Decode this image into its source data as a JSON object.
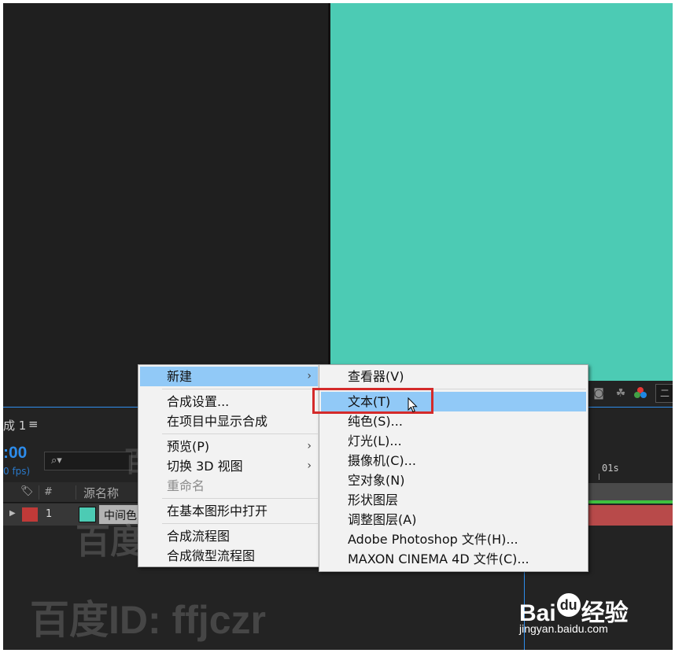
{
  "composition": {
    "canvas_color": "#4ccbb4",
    "tab_label": "成 1",
    "tab_menu": "≡",
    "timecode": ":00",
    "fps": "0 fps)",
    "search_glyph": "⌕▾"
  },
  "layers": {
    "col_num": "#",
    "col_source_name": "源名称",
    "rows": [
      {
        "expand": "▶",
        "label_color": "#c03a38",
        "number": "1",
        "name": "中间色"
      }
    ]
  },
  "timeline": {
    "ruler_label": "01s",
    "accent": "#2d8ceb",
    "bar_color": "#b84a4a"
  },
  "context_menu": {
    "items": [
      {
        "label": "新建",
        "arrow": "›"
      },
      {
        "label": "合成设置..."
      },
      {
        "label": "在项目中显示合成"
      },
      {
        "label": "预览(P)",
        "arrow": "›"
      },
      {
        "label": "切换 3D 视图",
        "arrow": "›"
      },
      {
        "label": "重命名"
      },
      {
        "label": "在基本图形中打开"
      },
      {
        "label": "合成流程图"
      },
      {
        "label": "合成微型流程图"
      }
    ]
  },
  "submenu_new": {
    "items": [
      {
        "label": "查看器(V)"
      },
      {
        "label": "文本(T)"
      },
      {
        "label": "纯色(S)..."
      },
      {
        "label": "灯光(L)..."
      },
      {
        "label": "摄像机(C)..."
      },
      {
        "label": "空对象(N)"
      },
      {
        "label": "形状图层"
      },
      {
        "label": "调整图层(A)"
      },
      {
        "label": "Adobe Photoshop 文件(H)..."
      },
      {
        "label": "MAXON CINEMA 4D 文件(C)..."
      }
    ]
  },
  "watermark": {
    "text": "百度ID: ffjczr"
  },
  "branding": {
    "logo_prefix": "Bai",
    "logo_paw": "du",
    "logo_suffix": "经验",
    "url": "jingyan.baidu.com"
  }
}
